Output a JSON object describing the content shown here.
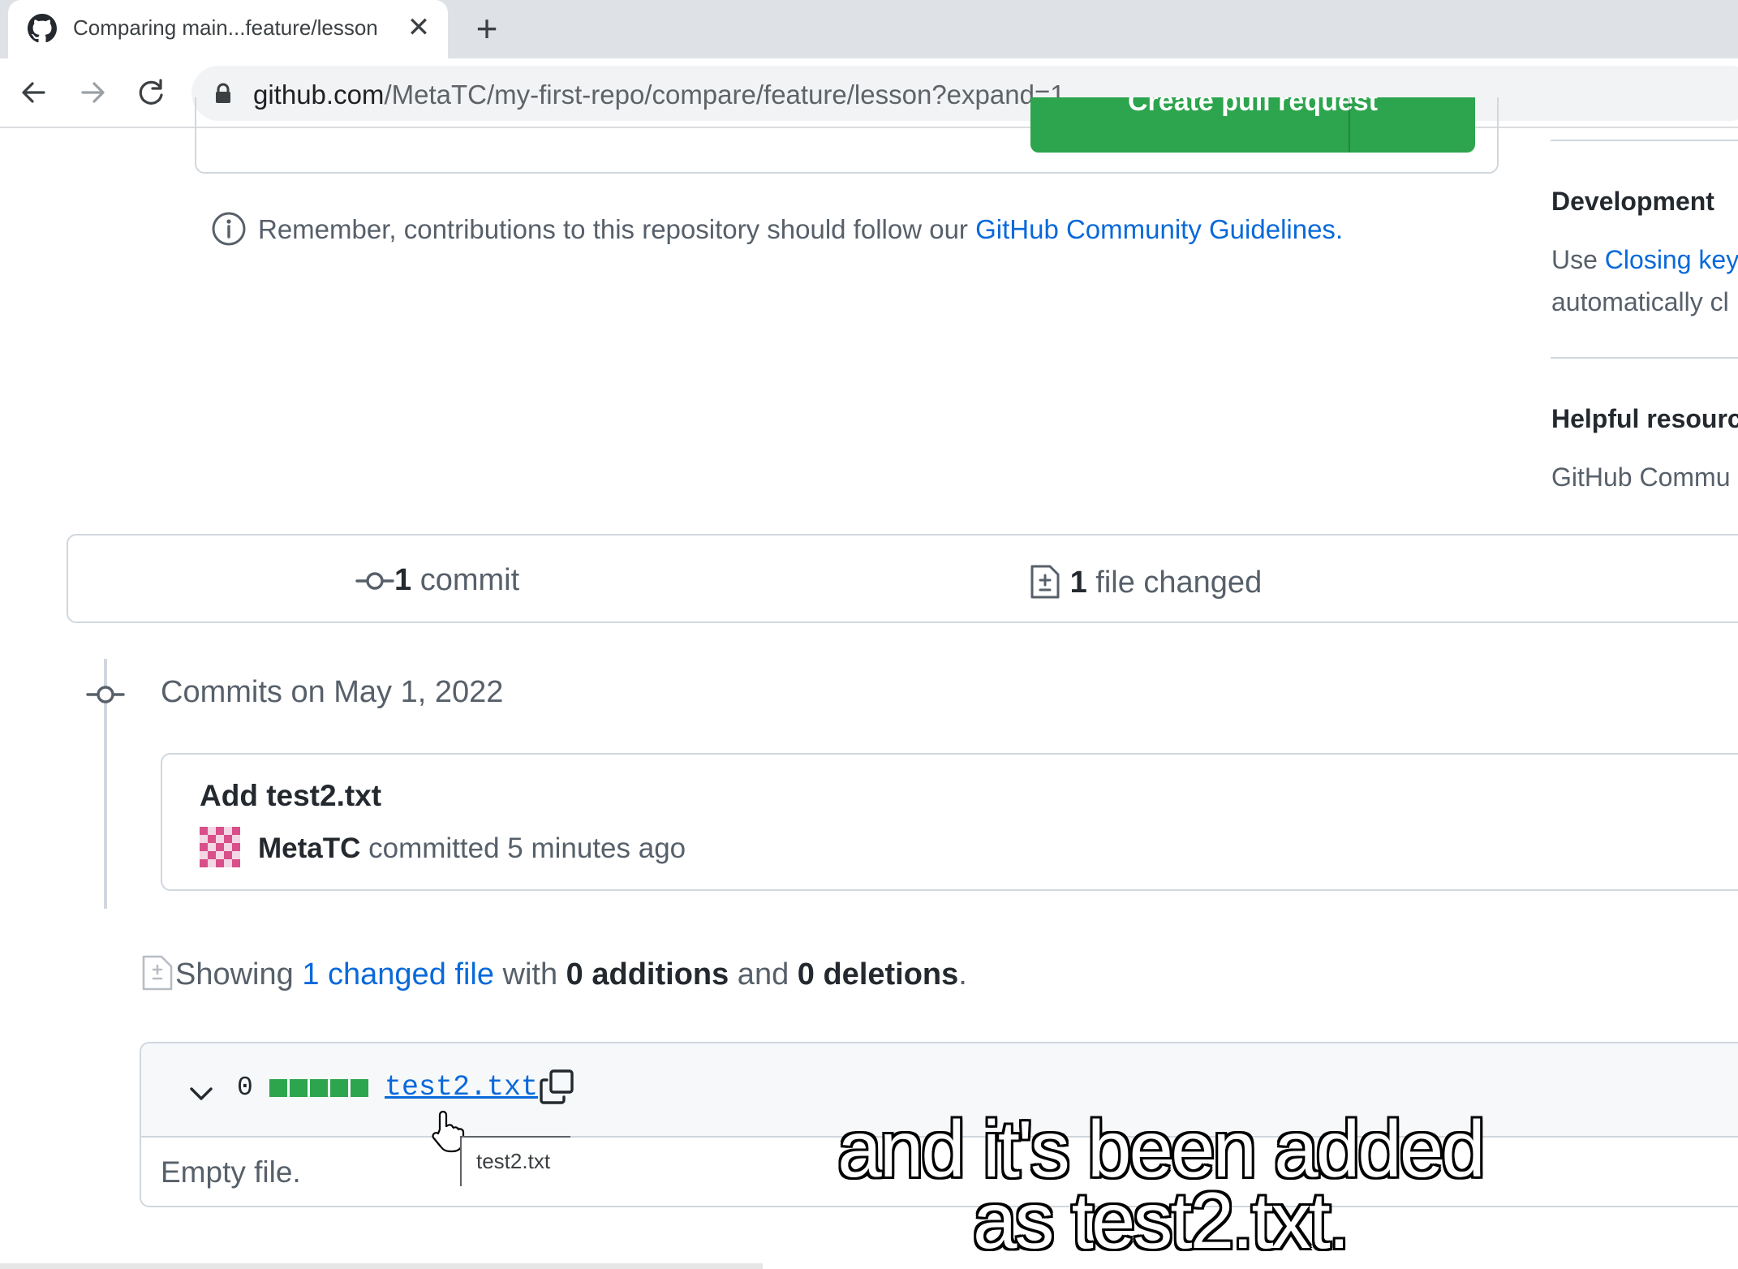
{
  "browser": {
    "tab_title": "Comparing main...feature/lesson",
    "new_tab_symbol": "+",
    "close_symbol": "✕",
    "url_host": "github.com",
    "url_path": "/MetaTC/my-first-repo/compare/feature/lesson?expand=1"
  },
  "pr_form": {
    "create_button_label": "Create pull request"
  },
  "notice": {
    "text": "Remember, contributions to this repository should follow our ",
    "link_text": "GitHub Community Guidelines",
    "trailing": "."
  },
  "sidebar": {
    "development_heading": "Development",
    "development_prefix": "Use ",
    "development_link": "Closing key",
    "development_line2": "automatically cl",
    "resources_heading": "Helpful resourc",
    "resources_link": "GitHub Commu"
  },
  "summary": {
    "commit_count": "1",
    "commit_label": " commit",
    "files_count": "1",
    "files_label": " file changed"
  },
  "commits": {
    "date_heading": "Commits on May 1, 2022",
    "message": "Add test2.txt",
    "author": "MetaTC",
    "meta": " committed 5 minutes ago"
  },
  "diff_summary": {
    "prefix": "Showing ",
    "changed_link": "1 changed file",
    "with": " with ",
    "additions": "0 additions",
    "and": " and ",
    "deletions": "0 deletions",
    "end": "."
  },
  "file": {
    "diff_count": "0",
    "name": "test2.txt",
    "body": "Empty file.",
    "tooltip": "test2.txt"
  },
  "caption": {
    "line1": "and it's been added",
    "line2": "as test2.txt."
  },
  "colors": {
    "accent_green": "#2da44e",
    "link_blue": "#0969da",
    "muted_text": "#57606a",
    "border": "#d0d7de"
  },
  "icons": [
    "github-icon",
    "close-icon",
    "plus-icon",
    "back-arrow-icon",
    "forward-arrow-icon",
    "reload-icon",
    "lock-icon",
    "info-icon",
    "git-commit-icon",
    "file-diff-icon",
    "avatar-identicon",
    "chevron-down-icon",
    "copy-icon",
    "hand-cursor-icon"
  ]
}
